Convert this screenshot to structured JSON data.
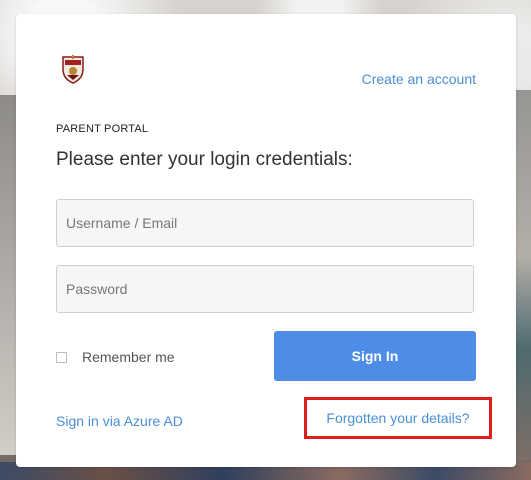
{
  "header": {
    "create_account_label": "Create an account"
  },
  "form": {
    "portal_label": "PARENT PORTAL",
    "prompt": "Please enter your login credentials:",
    "username_placeholder": "Username / Email",
    "username_value": "",
    "password_placeholder": "Password",
    "password_value": "",
    "remember_label": "Remember me",
    "remember_checked": false,
    "signin_label": "Sign In",
    "azure_label": "Sign in via Azure AD",
    "forgot_label": "Forgotten your details?"
  },
  "icons": {
    "logo": "school-crest-logo",
    "checkbox": "checkbox-unchecked-icon"
  },
  "colors": {
    "link": "#4a8fd6",
    "button": "#4d8de7",
    "highlight": "#e01c1c"
  }
}
